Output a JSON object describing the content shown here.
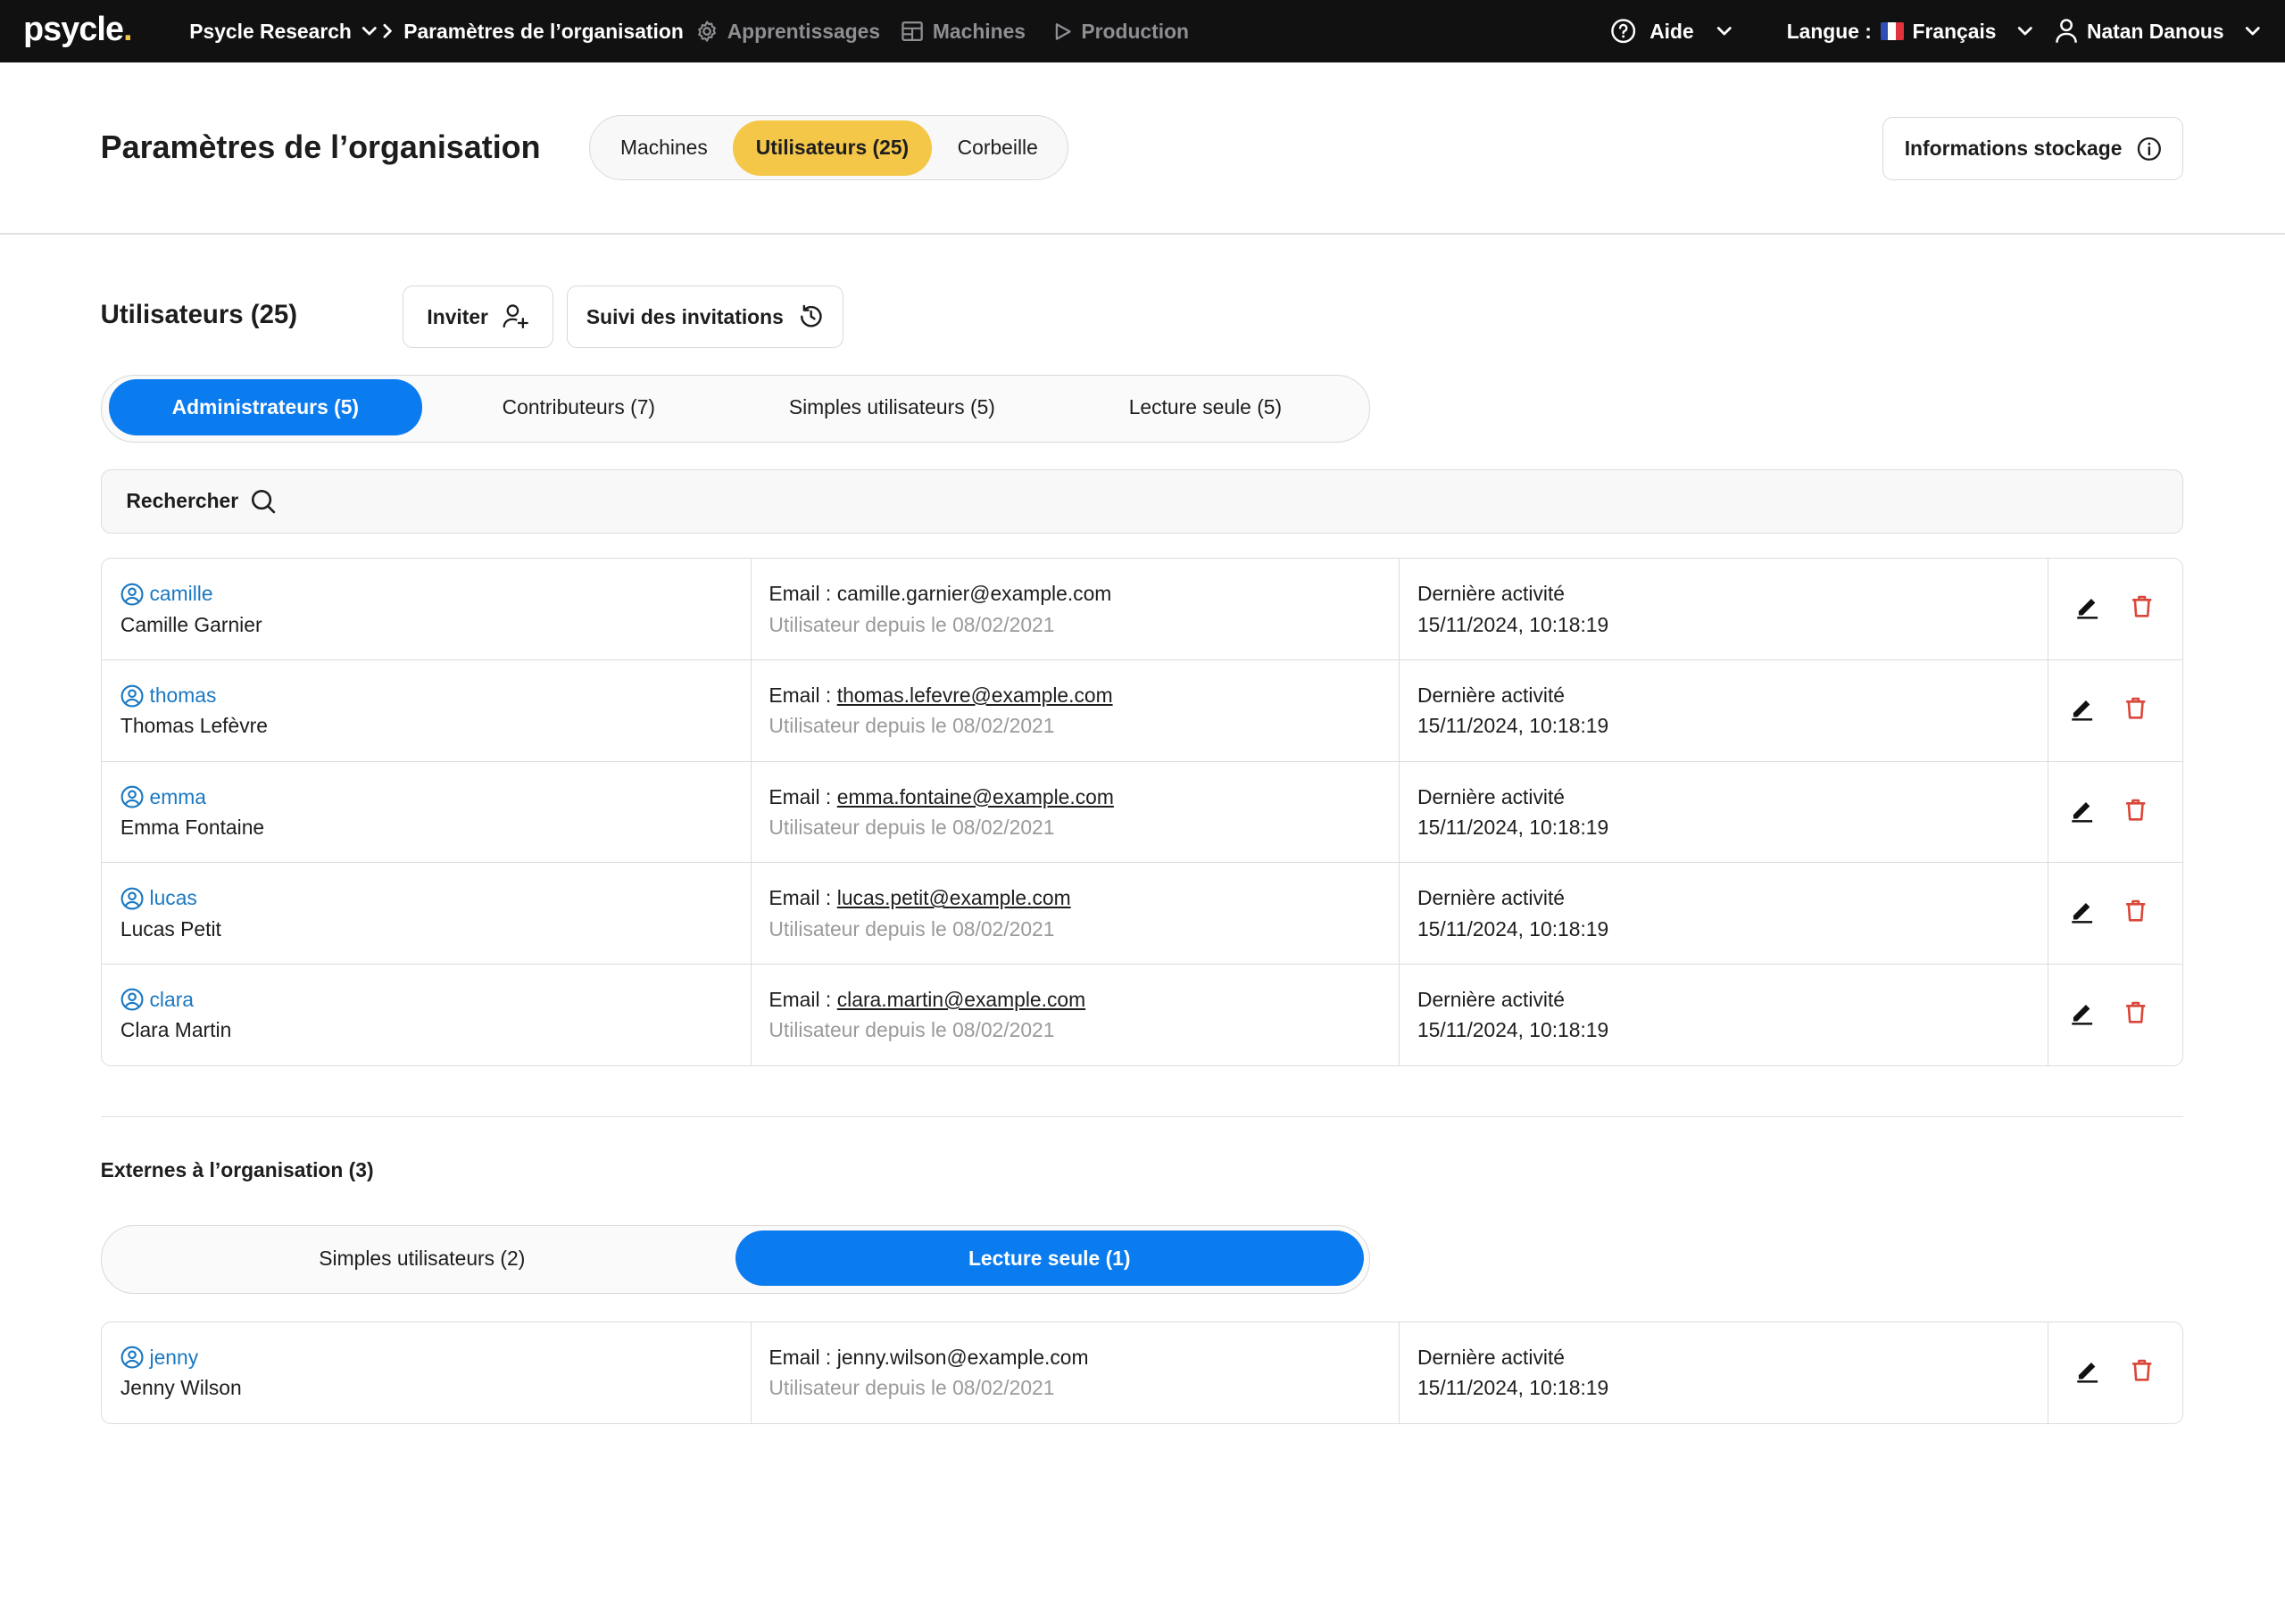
{
  "nav": {
    "logo": "psycle",
    "logo_dot": ".",
    "org": "Psycle Research",
    "breadcrumb": "Paramètres de l’organisation",
    "apprentissages": "Apprentissages",
    "machines": "Machines",
    "production": "Production",
    "aide": "Aide",
    "langue_label": "Langue :",
    "langue": "Français",
    "user": "Natan Danous"
  },
  "header": {
    "title": "Paramètres de l’organisation",
    "tabs": [
      "Machines",
      "Utilisateurs (25)",
      "Corbeille"
    ],
    "active_tab": "Utilisateurs (25)",
    "storage_button": "Informations stockage"
  },
  "users": {
    "title": "Utilisateurs (25)",
    "invite_button": "Inviter",
    "invitations_button": "Suivi des invitations",
    "role_tabs": [
      "Administrateurs (5)",
      "Contributeurs (7)",
      "Simples utilisateurs (5)",
      "Lecture seule (5)"
    ],
    "active_role": "Administrateurs (5)",
    "search_label": "Rechercher",
    "email_prefix": "Email : ",
    "rows": [
      {
        "username": "camille",
        "fullname": "Camille Garnier",
        "email": "camille.garnier@example.com",
        "since": "Utilisateur depuis le 08/02/2021",
        "activity_label": "Dernière activité",
        "activity": "15/11/2024, 10:18:19"
      },
      {
        "username": "thomas",
        "fullname": "Thomas Lefèvre",
        "email": "thomas.lefevre@example.com",
        "since": "Utilisateur depuis le 08/02/2021",
        "activity_label": "Dernière activité",
        "activity": "15/11/2024, 10:18:19"
      },
      {
        "username": "emma",
        "fullname": "Emma Fontaine",
        "email": "emma.fontaine@example.com",
        "since": "Utilisateur depuis le 08/02/2021",
        "activity_label": "Dernière activité",
        "activity": "15/11/2024, 10:18:19"
      },
      {
        "username": "lucas",
        "fullname": "Lucas Petit",
        "email": "lucas.petit@example.com",
        "since": "Utilisateur depuis le 08/02/2021",
        "activity_label": "Dernière activité",
        "activity": "15/11/2024, 10:18:19"
      },
      {
        "username": "clara",
        "fullname": "Clara Martin",
        "email": "clara.martin@example.com",
        "since": "Utilisateur depuis le 08/02/2021",
        "activity_label": "Dernière activité",
        "activity": "15/11/2024, 10:18:19"
      }
    ]
  },
  "externals": {
    "title": "Externes à l’organisation (3)",
    "role_tabs": [
      "Simples utilisateurs (2)",
      "Lecture seule (1)"
    ],
    "active_role": "Lecture seule (1)",
    "rows": [
      {
        "username": "jenny",
        "fullname": "Jenny Wilson",
        "email": "jenny.wilson@example.com",
        "since": "Utilisateur depuis le 08/02/2021",
        "activity_label": "Dernière activité",
        "activity": "15/11/2024, 10:18:19"
      }
    ]
  },
  "icons": {
    "chevron": "chevron-down-icon",
    "breadcrumb_sep": "chevron-right-icon",
    "apprentissages": "gear-icon",
    "machines": "server-icon",
    "production": "play-icon",
    "aide": "help-circle-icon",
    "user": "user-icon",
    "flag": "flag-fr-icon",
    "storage_info": "info-icon",
    "invite": "user-plus-icon",
    "invitations": "history-icon",
    "search": "search-icon",
    "row_user": "user-circle-icon",
    "edit": "pencil-icon",
    "delete": "trash-icon"
  },
  "colors": {
    "topbar": "#111111",
    "accent_yellow": "#f4c748",
    "accent_blue": "#0b7bf0",
    "username_blue": "#1a78c2",
    "delete_red": "#d9473a"
  }
}
